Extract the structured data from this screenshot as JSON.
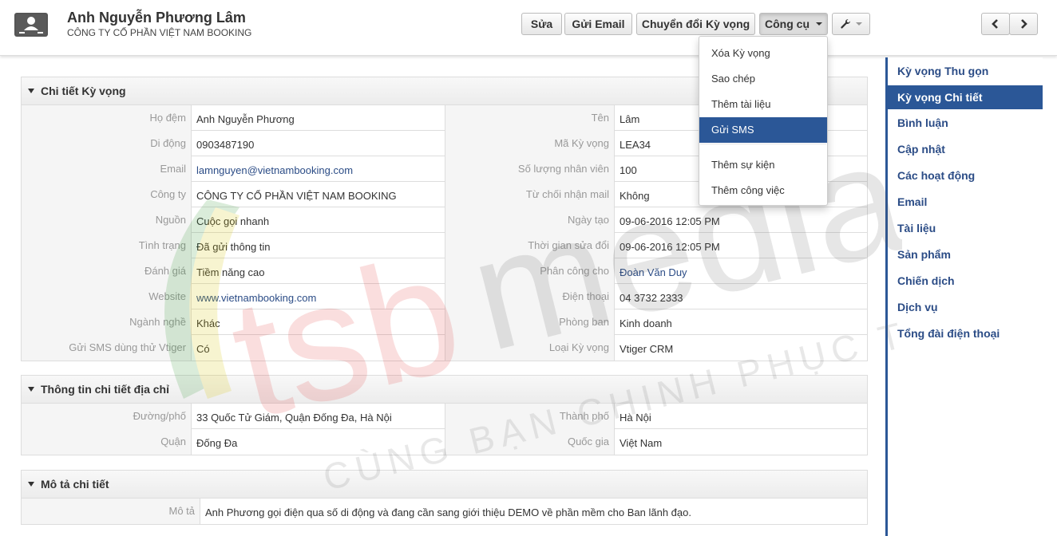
{
  "header": {
    "name": "Anh Nguyễn Phương Lâm",
    "company": "CÔNG TY CỔ PHẦN VIỆT NAM BOOKING",
    "icon": "contact-card-icon",
    "buttons": {
      "edit": "Sửa",
      "send_email": "Gửi Email",
      "convert": "Chuyển đổi Kỳ vọng",
      "tools": "Công cụ"
    },
    "icons": {
      "settings": "wrench-icon",
      "prev": "chevron-left-icon",
      "next": "chevron-right-icon"
    }
  },
  "tools_menu": {
    "items": [
      "Xóa Kỳ vọng",
      "Sao chép",
      "Thêm tài liệu",
      "Gửi SMS",
      "Thêm sự kiện",
      "Thêm công việc"
    ],
    "selected": "Gửi SMS"
  },
  "details": {
    "title": "Chi tiết Kỳ vọng",
    "rows": [
      {
        "l1": "Họ đệm",
        "v1": "Anh Nguyễn Phương",
        "l2": "Tên",
        "v2": "Lâm"
      },
      {
        "l1": "Di động",
        "v1": "0903487190",
        "l2": "Mã Kỳ vọng",
        "v2": "LEA34"
      },
      {
        "l1": "Email",
        "v1": "lamnguyen@vietnambooking.com",
        "l2": "Số lượng nhân viên",
        "v2": "100"
      },
      {
        "l1": "Công ty",
        "v1": "CÔNG TY CỔ PHẦN VIỆT NAM BOOKING",
        "l2": "Từ chối nhận mail",
        "v2": "Không"
      },
      {
        "l1": "Nguồn",
        "v1": "Cuộc gọi nhanh",
        "l2": "Ngày tạo",
        "v2": "09-06-2016 12:05 PM"
      },
      {
        "l1": "Tình trạng",
        "v1": "Đã gửi thông tin",
        "l2": "Thời gian sửa đổi",
        "v2": "09-06-2016 12:05 PM"
      },
      {
        "l1": "Đánh giá",
        "v1": "Tiềm năng cao",
        "l2": "Phân công cho",
        "v2": "Đoàn Văn Duy"
      },
      {
        "l1": "Website",
        "v1": "www.vietnambooking.com",
        "l2": "Điện thoại",
        "v2": "04 3732 2333"
      },
      {
        "l1": "Ngành nghề",
        "v1": "Khác",
        "l2": "Phòng ban",
        "v2": "Kinh doanh"
      },
      {
        "l1": "Gửi SMS dùng thử Vtiger",
        "v1": "Có",
        "l2": "Loại Kỳ vọng",
        "v2": "Vtiger CRM"
      }
    ]
  },
  "address": {
    "title": "Thông tin chi tiết địa chỉ",
    "rows": [
      {
        "l1": "Đường/phố",
        "v1": "33 Quốc Tử Giám, Quận Đống Đa, Hà Nội",
        "l2": "Thành phố",
        "v2": "Hà Nội"
      },
      {
        "l1": "Quận",
        "v1": "Đống Đa",
        "l2": "Quốc gia",
        "v2": "Việt Nam"
      }
    ]
  },
  "description": {
    "title": "Mô tả chi tiết",
    "label": "Mô tả",
    "value": "Anh Phương gọi điện qua số di động và đang cần sang giới thiệu DEMO về phần mềm cho Ban lãnh đạo."
  },
  "sidebar": {
    "items": [
      "Kỳ vọng Thu gọn",
      "Kỳ vọng Chi tiết",
      "Bình luận",
      "Cập nhật",
      "Các hoạt động",
      "Email",
      "Tài liệu",
      "Sản phẩm",
      "Chiến dịch",
      "Dịch vụ",
      "Tổng đài điện thoại"
    ],
    "active": "Kỳ vọng Chi tiết"
  },
  "watermark": {
    "brand_a": "tsb",
    "brand_b": "media",
    "slogan": "CÙNG BẠN CHINH PHỤC THỊ TRƯỜNG"
  },
  "colors": {
    "accent": "#2b5797",
    "link": "#2b4c86",
    "label": "#999999"
  }
}
